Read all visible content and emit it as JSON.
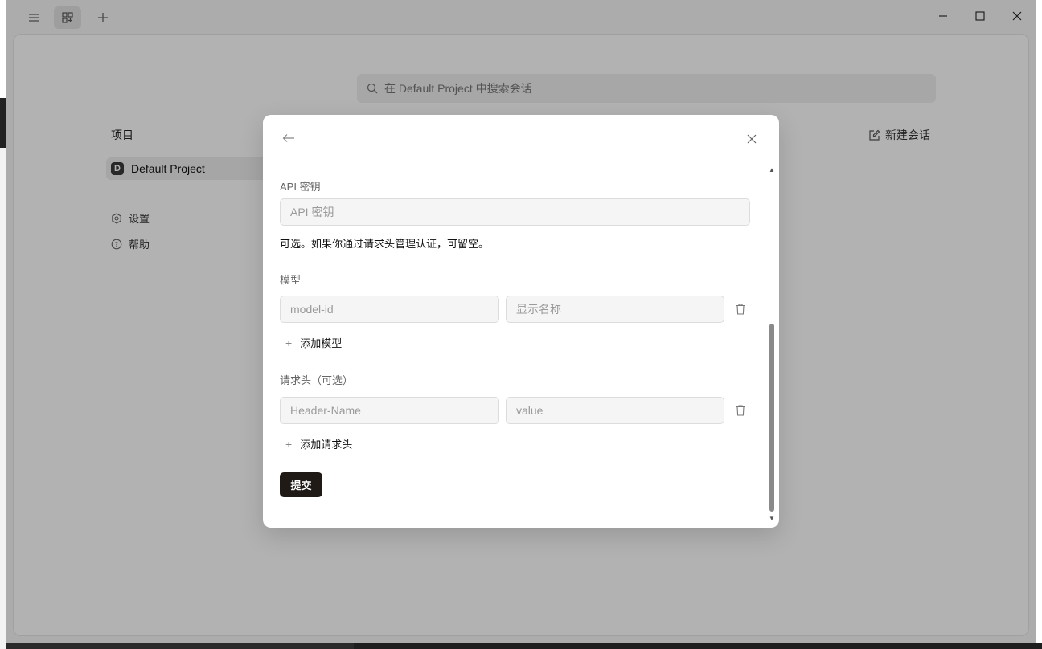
{
  "search": {
    "placeholder": "在 Default Project 中搜索会话"
  },
  "sidebar": {
    "projects_title": "项目",
    "project": {
      "badge": "D",
      "name": "Default Project"
    },
    "settings_label": "设置",
    "help_label": "帮助"
  },
  "header": {
    "new_chat_label": "新建会话"
  },
  "modal": {
    "api_key_label": "API 密钥",
    "api_key_placeholder": "API 密钥",
    "api_key_hint": "可选。如果你通过请求头管理认证，可留空。",
    "models_label": "模型",
    "model_id_placeholder": "model-id",
    "display_name_placeholder": "显示名称",
    "add_model_label": "添加模型",
    "headers_label": "请求头（可选）",
    "header_name_placeholder": "Header-Name",
    "header_value_placeholder": "value",
    "add_header_label": "添加请求头",
    "submit_label": "提交"
  }
}
